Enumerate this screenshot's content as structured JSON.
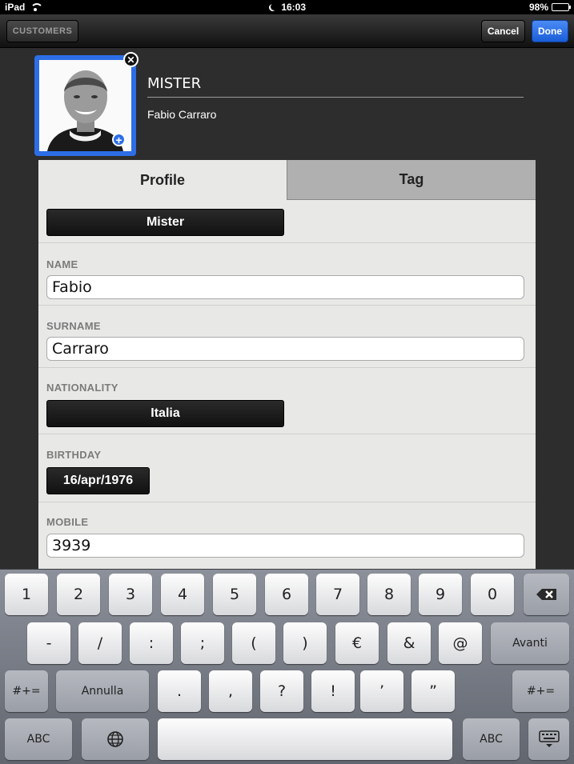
{
  "status": {
    "device": "iPad",
    "time": "16:03",
    "battery": "98%",
    "battery_level": 0.98
  },
  "nav": {
    "back": "CUSTOMERS",
    "cancel": "Cancel",
    "done": "Done"
  },
  "header": {
    "title": "MISTER",
    "subtitle": "Fabio Carraro"
  },
  "tabs": [
    {
      "label": "Profile"
    },
    {
      "label": "Tag"
    }
  ],
  "form": {
    "title_value": "Mister",
    "name_label": "NAME",
    "name_value": "Fabio",
    "surname_label": "SURNAME",
    "surname_value": "Carraro",
    "nationality_label": "NATIONALITY",
    "nationality_value": "Italia",
    "birthday_label": "BIRTHDAY",
    "birthday_value": "16/apr/1976",
    "mobile_label": "MOBILE",
    "mobile_value": "3939"
  },
  "keyboard": {
    "row1": [
      "1",
      "2",
      "3",
      "4",
      "5",
      "6",
      "7",
      "8",
      "9",
      "0"
    ],
    "row2": [
      "-",
      "/",
      ":",
      ";",
      "(",
      ")",
      "€",
      "&",
      "@"
    ],
    "row2_action": "Avanti",
    "row3_left": "#+=",
    "row3_undo": "Annulla",
    "row3": [
      ".",
      ",",
      "?",
      "!",
      "’",
      "”"
    ],
    "row3_right": "#+=",
    "row4_abc_left": "ABC",
    "row4_abc_right": "ABC"
  },
  "colors": {
    "accent": "#2d6ee6",
    "done_button": "#1a5ed8"
  }
}
